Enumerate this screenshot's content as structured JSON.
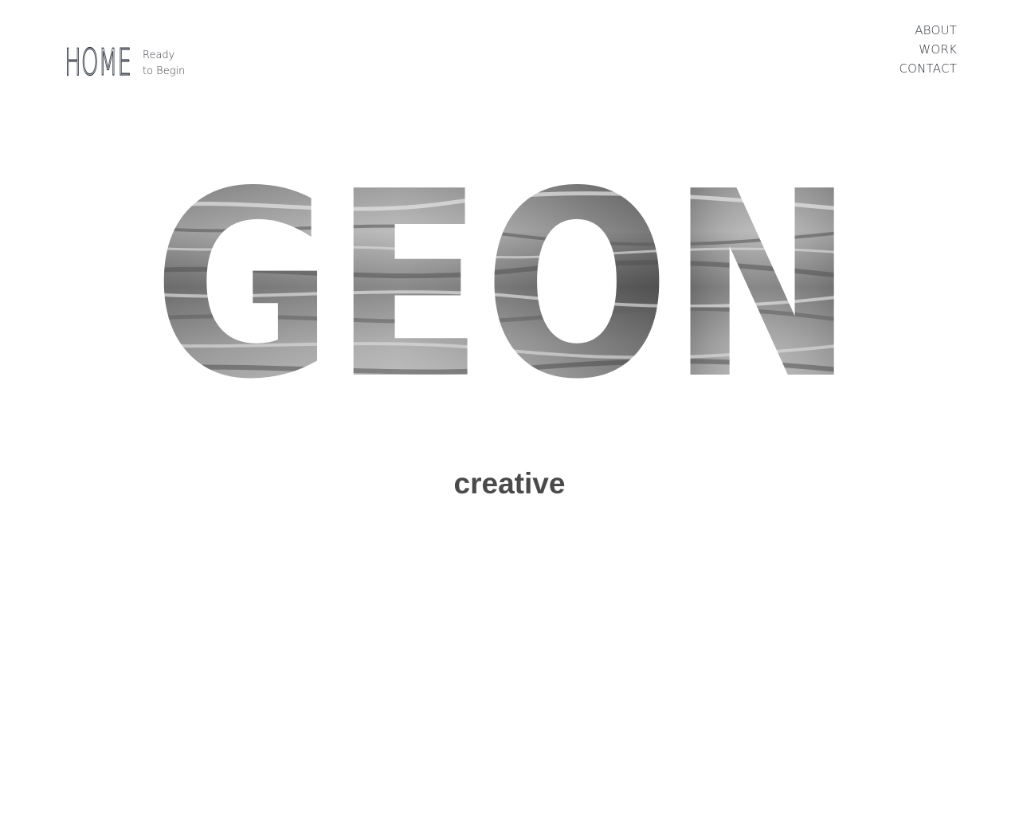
{
  "brand": {
    "logo_text": "HOME",
    "tagline_line1": "Ready",
    "tagline_line2": "to Begin"
  },
  "nav": {
    "items": [
      {
        "label": "ABOUT"
      },
      {
        "label": "WORK"
      },
      {
        "label": "CONTACT"
      }
    ]
  },
  "hero": {
    "title": "GEON",
    "texture": "grayscale-water-surface",
    "subtitle": "creative"
  },
  "colors": {
    "background": "#ffffff",
    "text_dark": "#2a2e35",
    "subtitle": "#4a4a4a"
  }
}
